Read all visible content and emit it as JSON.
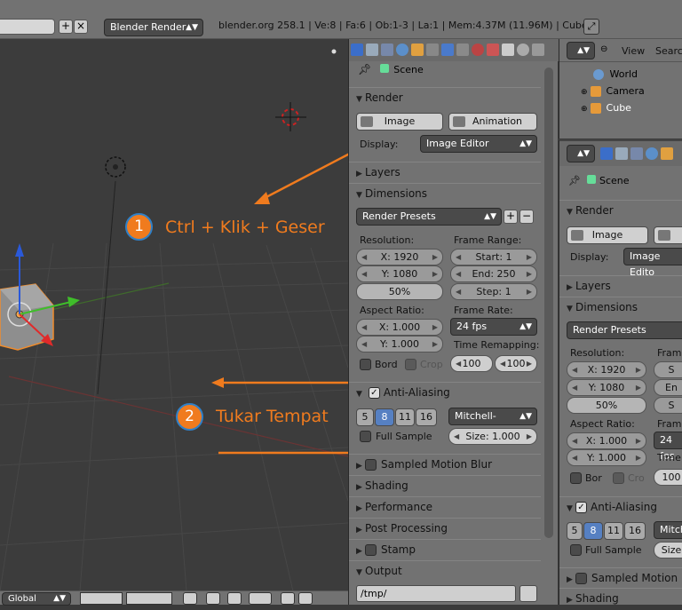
{
  "topbar": {
    "render_engine": "Blender Render",
    "info": "blender.org 258.1 | Ve:8 | Fa:6 | Ob:1-3 | La:1 | Mem:4.37M (11.96M) | Cube"
  },
  "annotations": {
    "step1_number": "1",
    "step1_text": "Ctrl + Klik + Geser",
    "step2_number": "2",
    "step2_text": "Tukar Tempat"
  },
  "bottombar": {
    "orientation": "Global"
  },
  "properties": {
    "breadcrumb": "Scene",
    "render": {
      "title": "Render",
      "image_btn": "Image",
      "animation_btn": "Animation",
      "display_label": "Display:",
      "display_value": "Image Editor"
    },
    "layers_title": "Layers",
    "dimensions": {
      "title": "Dimensions",
      "presets": "Render Presets",
      "resolution_label": "Resolution:",
      "res_x": "X: 1920",
      "res_y": "Y: 1080",
      "res_pct": "50%",
      "frame_range_label": "Frame Range:",
      "start": "Start: 1",
      "end": "End: 250",
      "step": "Step: 1",
      "aspect_label": "Aspect Ratio:",
      "aspect_x": "X: 1.000",
      "aspect_y": "Y: 1.000",
      "frame_rate_label": "Frame Rate:",
      "fps": "24 fps",
      "bord": "Bord",
      "crop": "Crop",
      "time_remap_label": "Time Remapping:",
      "remap_old": "100",
      "remap_new": "100"
    },
    "aa": {
      "title": "Anti-Aliasing",
      "s5": "5",
      "s8": "8",
      "s11": "11",
      "s16": "16",
      "filter": "Mitchell-Netra",
      "full_sample": "Full Sample",
      "size": "Size: 1.000"
    },
    "motion_blur": "Sampled Motion Blur",
    "shading": "Shading",
    "performance": "Performance",
    "post": "Post Processing",
    "stamp": "Stamp",
    "output_title": "Output",
    "output_path": "/tmp/"
  },
  "outliner": {
    "view": "View",
    "search": "Searc",
    "world": "World",
    "camera": "Camera",
    "cube": "Cube"
  },
  "properties2": {
    "breadcrumb": "Scene",
    "render_title": "Render",
    "image_btn": "Image",
    "display_label": "Display:",
    "display_value": "Image Edito",
    "layers_title": "Layers",
    "dimensions_title": "Dimensions",
    "presets": "Render Presets",
    "resolution_label": "Resolution:",
    "frame_label": "Frame",
    "res_x": "X: 1920",
    "res_y": "Y: 1080",
    "res_pct": "50%",
    "s1": "S",
    "en": "En",
    "s2": "S",
    "aspect_label": "Aspect Ratio:",
    "frame2_label": "Frame",
    "aspect_x": "X: 1.000",
    "aspect_y": "Y: 1.000",
    "fps": "24 fps",
    "time_label": "Time",
    "bor": "Bor",
    "cro": "Cro",
    "remap": "100",
    "aa_title": "Anti-Aliasing",
    "s5": "5",
    "s8": "8",
    "s11": "11",
    "s16": "16",
    "filter": "Mitch",
    "full_sample": "Full Sample",
    "size": "Size",
    "motion_blur": "Sampled Motion B",
    "shading": "Shading"
  }
}
